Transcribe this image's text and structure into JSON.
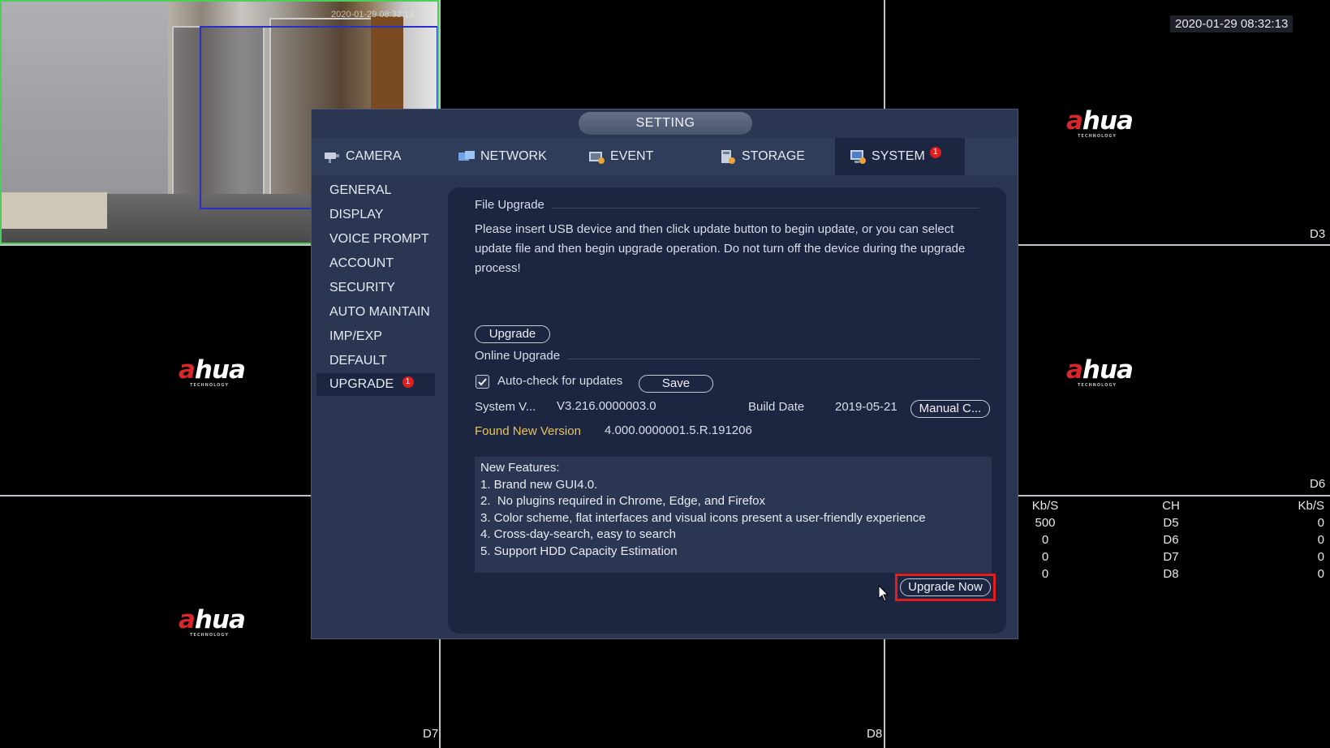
{
  "overlay": {
    "datetime": "2020-01-29 08:32:13",
    "camera_timestamp": "2020-01-29 08:32:13",
    "logo_text": "hua",
    "logo_mark": "a",
    "logo_sub": "TECHNOLOGY",
    "channels": [
      "D3",
      "D6",
      "D7",
      "D8"
    ],
    "bandwidth": {
      "headers": [
        "Kb/S",
        "CH",
        "Kb/S"
      ],
      "rows": [
        [
          "500",
          "D5",
          "0"
        ],
        [
          "0",
          "D6",
          "0"
        ],
        [
          "0",
          "D7",
          "0"
        ],
        [
          "0",
          "D8",
          "0"
        ]
      ]
    }
  },
  "window": {
    "title": "SETTING",
    "tabs": [
      {
        "label": "CAMERA",
        "icon": "camera-icon"
      },
      {
        "label": "NETWORK",
        "icon": "network-icon"
      },
      {
        "label": "EVENT",
        "icon": "event-icon"
      },
      {
        "label": "STORAGE",
        "icon": "storage-icon"
      },
      {
        "label": "SYSTEM",
        "icon": "system-icon",
        "badge": "1",
        "active": true
      }
    ],
    "sidebar": [
      {
        "label": "GENERAL"
      },
      {
        "label": "DISPLAY"
      },
      {
        "label": "VOICE PROMPT"
      },
      {
        "label": "ACCOUNT"
      },
      {
        "label": "SECURITY"
      },
      {
        "label": "AUTO MAINTAIN"
      },
      {
        "label": "IMP/EXP"
      },
      {
        "label": "DEFAULT"
      },
      {
        "label": "UPGRADE",
        "badge": "1",
        "active": true
      }
    ]
  },
  "file_upgrade": {
    "title": "File Upgrade",
    "description": "Please insert USB device and then click update button to begin update, or you can select update file and then begin upgrade operation. Do not turn off the device during the upgrade process!",
    "upgrade_button": "Upgrade"
  },
  "online_upgrade": {
    "title": "Online Upgrade",
    "auto_check_label": "Auto-check for updates",
    "auto_check_checked": true,
    "save_button": "Save",
    "system_version_label": "System V...",
    "system_version_value": "V3.216.0000003.0",
    "build_date_label": "Build Date",
    "build_date_value": "2019-05-21",
    "manual_check_button": "Manual C...",
    "found_new_version_label": "Found New Version",
    "found_new_version_value": "4.000.0000001.5.R.191206",
    "features": [
      "New Features:",
      "1. Brand new GUI4.0.",
      "2.  No plugins required in Chrome, Edge, and Firefox",
      "3. Color scheme, flat interfaces and visual icons present a user-friendly experience",
      "4. Cross-day-search, easy to search",
      "5. Support HDD Capacity Estimation"
    ],
    "upgrade_now_button": "Upgrade Now"
  },
  "colors": {
    "highlight": "#e11d1d",
    "window_bg": "#2a3652",
    "panel_bg": "#1c2641",
    "feed_border": "#4ccf5a",
    "motion_box": "#2731c9"
  }
}
